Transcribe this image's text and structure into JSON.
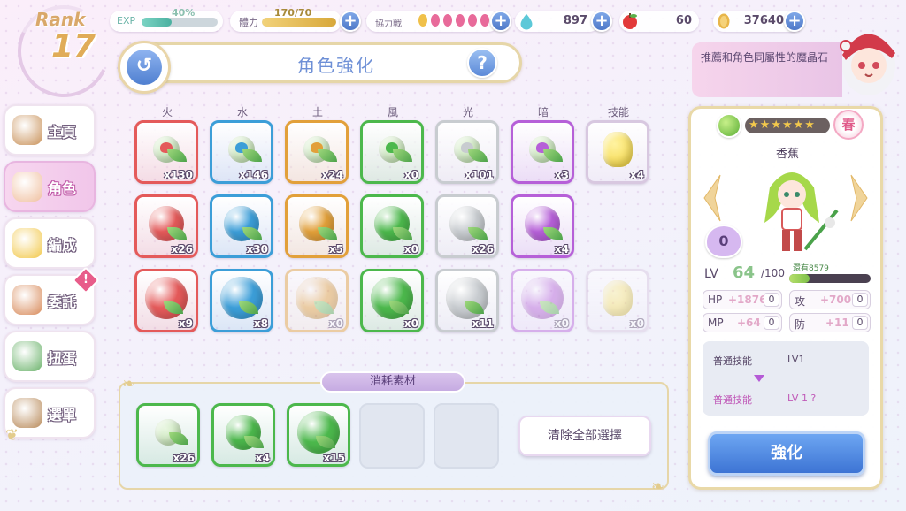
{
  "rank": {
    "label": "Rank",
    "value": "17"
  },
  "topbar": {
    "exp": {
      "label": "EXP",
      "percent_text": "40%",
      "fraction": 0.4
    },
    "stamina": {
      "label": "體力",
      "value": "170/70",
      "fraction": 1.0
    },
    "coop": {
      "label": "協力戰",
      "tokens": 6
    },
    "water_drop": {
      "value": "897"
    },
    "apple": {
      "value": "60"
    },
    "gold": {
      "value": "37640"
    }
  },
  "title": "角色強化",
  "hint": "推薦和角色同屬性的魔晶石",
  "side_menu": [
    {
      "id": "home",
      "label": "主頁",
      "color": "#c9925a"
    },
    {
      "id": "character",
      "label": "角色",
      "color": "#f0c0a0",
      "active": true
    },
    {
      "id": "formation",
      "label": "編成",
      "color": "#f2c84a"
    },
    {
      "id": "commission",
      "label": "委託",
      "color": "#d88a5a"
    },
    {
      "id": "gacha",
      "label": "扭蛋",
      "color": "#6ab26a"
    },
    {
      "id": "menu",
      "label": "選單",
      "color": "#b88a5a"
    }
  ],
  "alert": "!",
  "columns": [
    "火",
    "水",
    "土",
    "風",
    "光",
    "暗",
    "技能"
  ],
  "colors": {
    "fire": "#e45a5a",
    "water": "#3c9ed8",
    "earth": "#e2a03a",
    "wind": "#4cb84c",
    "light": "#c8ccd0",
    "dark": "#b660d8",
    "skill": "#d8c8e0"
  },
  "grid": {
    "row1": [
      "x130",
      "x146",
      "x24",
      "x0",
      "x101",
      "x3",
      "x4"
    ],
    "row2": [
      "x26",
      "x30",
      "x5",
      "x0",
      "x26",
      "x4"
    ],
    "row3": [
      "x9",
      "x8",
      "x0",
      "x0",
      "x11",
      "x0",
      "x0"
    ]
  },
  "materials": {
    "title": "消耗素材",
    "items": [
      "x26",
      "x4",
      "x15"
    ],
    "clear_button": "清除全部選擇"
  },
  "character": {
    "season": "春",
    "name": "香蕉",
    "affection": "0",
    "level_label": "LV",
    "level": "64",
    "level_max": "/100",
    "remaining": "還有8579",
    "level_fill": 0.25,
    "stars": 6,
    "stats": {
      "hp": {
        "label": "HP",
        "bonus": "+1876",
        "zero": "0"
      },
      "atk": {
        "label": "攻",
        "bonus": "+700",
        "zero": "0"
      },
      "mp": {
        "label": "MP",
        "bonus": "+64",
        "zero": "0"
      },
      "def": {
        "label": "防",
        "bonus": "+11",
        "zero": "0"
      }
    },
    "skill": {
      "name1": "普通技能",
      "lv1": "LV1",
      "name2": "普通技能",
      "lv2": "LV 1 ?"
    },
    "enhance_button": "強化"
  }
}
